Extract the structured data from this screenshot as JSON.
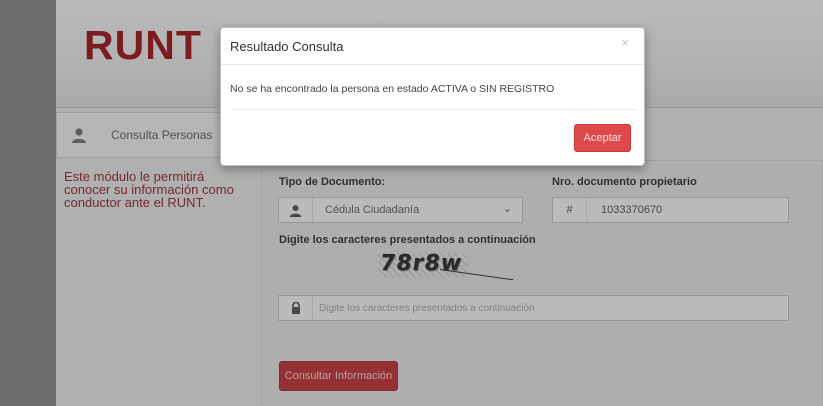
{
  "brand": {
    "logo_text": "RUNT",
    "logo_color": "#a5171c"
  },
  "nav": {
    "label": "Consulta Personas"
  },
  "left_info": {
    "text": "Este módulo le permitirá conocer su información como conductor ante el RUNT."
  },
  "form": {
    "doc_type_label": "Tipo de Documento:",
    "doc_type_value": "Cédula Ciudadanía",
    "doc_number_label": "Nro. documento propietario",
    "doc_number_prefix": "#",
    "doc_number_value": "1033370670",
    "captcha_label": "Digite los caracteres presentados a continuación",
    "captcha_text": "78r8w",
    "captcha_input_placeholder": "Digite los caracteres presentados a continuación",
    "submit_label": "Consultar Información"
  },
  "modal": {
    "title": "Resultado Consulta",
    "close_glyph": "×",
    "message": "No se ha encontrado la persona en estado ACTIVA o SIN REGISTRO",
    "accept_label": "Aceptar",
    "accept_color": "#de4a4a"
  },
  "icons": {
    "user": "user-icon",
    "lock": "lock-icon",
    "close": "close-icon",
    "caret": "chevron-down-icon"
  }
}
